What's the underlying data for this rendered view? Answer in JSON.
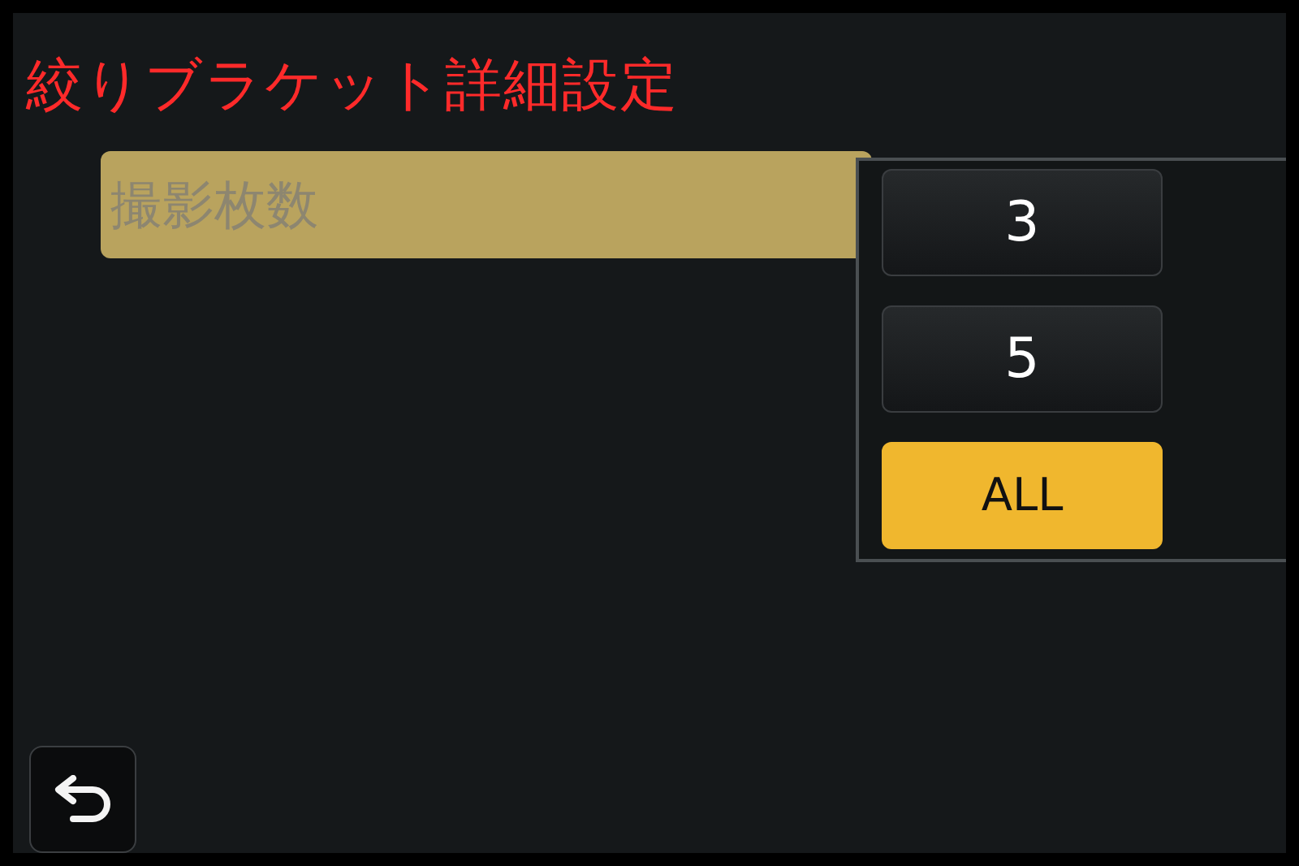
{
  "title": "絞りブラケット詳細設定",
  "menu_items": [
    {
      "label": "撮影枚数",
      "selected": true
    }
  ],
  "options": [
    {
      "label": "3",
      "selected": false
    },
    {
      "label": "5",
      "selected": false
    },
    {
      "label": "ALL",
      "selected": true
    }
  ],
  "back_button": {
    "kind": "return"
  }
}
